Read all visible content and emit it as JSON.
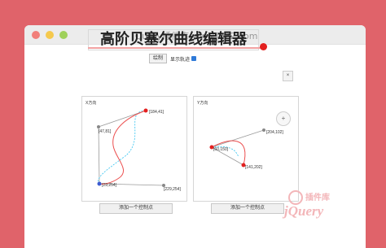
{
  "window": {
    "title": "jQuery插件库-www.jq22.com"
  },
  "headline": "高阶贝塞尔曲线编辑器",
  "controls": {
    "draw_label": "绘制",
    "show_track_label": "显示轨迹",
    "show_track_checked": true
  },
  "panels": [
    {
      "label": "X方向",
      "add_label": "添加一个控制点",
      "points": [
        {
          "label": "[184,41]"
        },
        {
          "label": "[47,81]"
        },
        {
          "label": "[29,254]"
        },
        {
          "label": "[229,254]"
        }
      ]
    },
    {
      "label": "Y方向",
      "add_label": "添加一个控制点",
      "points": [
        {
          "label": "[204,102]"
        },
        {
          "label": "[60,150]"
        },
        {
          "label": "[141,202]"
        }
      ]
    }
  ],
  "close_label": "×",
  "add_label": "+",
  "watermark": {
    "text": "插件库",
    "logo": "jQuery"
  },
  "colors": {
    "background": "#e0636a",
    "curve": "#ec4f4f",
    "track": "#33c3f0",
    "point": "#e3201f"
  }
}
